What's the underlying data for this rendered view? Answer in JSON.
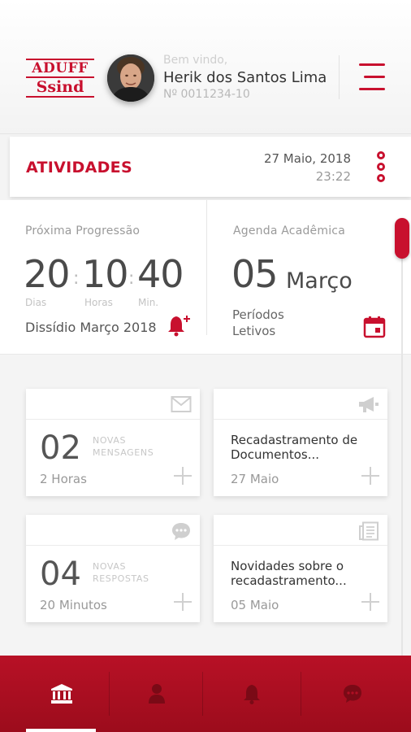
{
  "header": {
    "logo": {
      "line1": "ADUFF",
      "line2": "Ssind"
    },
    "welcome": "Bem vindo,",
    "user_name": "Herik dos Santos Lima",
    "user_id": "Nº 0011234-10"
  },
  "activities": {
    "title": "ATIVIDADES",
    "date": "27 Maio, 2018",
    "time": "23:22"
  },
  "progression": {
    "label": "Próxima Progressão",
    "days": "20",
    "hours": "10",
    "minutes": "40",
    "days_label": "Dias",
    "hours_label": "Horas",
    "minutes_label": "Min.",
    "event": "Dissídio Março 2018"
  },
  "agenda": {
    "label": "Agenda Acadêmica",
    "day": "05",
    "month": "Março",
    "event_line1": "Períodos",
    "event_line2": "Letivos"
  },
  "cards": [
    {
      "icon": "mail-icon",
      "number": "02",
      "tag_line1": "NOVAS",
      "tag_line2": "MENSAGENS",
      "footer": "2 Horas"
    },
    {
      "icon": "megaphone-icon",
      "title": "Recadastramento de Documentos...",
      "footer": "27 Maio"
    },
    {
      "icon": "chat-bubble-icon",
      "number": "04",
      "tag_line1": "NOVAS",
      "tag_line2": "RESPOSTAS",
      "footer": "20 Minutos"
    },
    {
      "icon": "news-icon",
      "title": "Novidades sobre o recadastramento...",
      "footer": "05 Maio"
    }
  ],
  "bottom_nav": [
    {
      "icon": "institution-icon",
      "active": true
    },
    {
      "icon": "person-icon",
      "active": false
    },
    {
      "icon": "bell-icon",
      "active": false
    },
    {
      "icon": "chat-icon",
      "active": false
    }
  ],
  "colors": {
    "accent": "#c8102e",
    "nav_bg": "#b01024"
  }
}
